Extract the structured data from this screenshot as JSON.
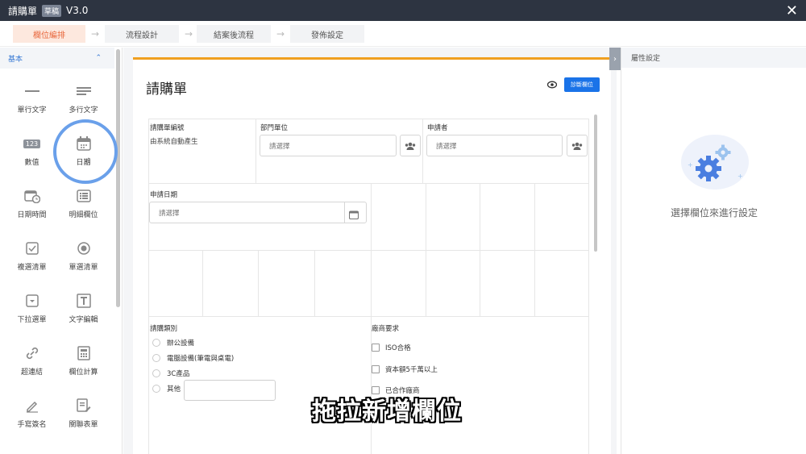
{
  "titlebar": {
    "title": "請購單",
    "badge": "草稿",
    "version": "V3.0"
  },
  "steps": [
    "欄位編排",
    "流程設計",
    "結案後流程",
    "發佈設定"
  ],
  "sidebar": {
    "section": "基本",
    "items": [
      {
        "label": "單行文字",
        "icon": "single-line-text-icon"
      },
      {
        "label": "多行文字",
        "icon": "multi-line-text-icon"
      },
      {
        "label": "數值",
        "icon": "number-icon",
        "glyph": "123"
      },
      {
        "label": "日期",
        "icon": "calendar-icon"
      },
      {
        "label": "日期時間",
        "icon": "datetime-icon"
      },
      {
        "label": "明細欄位",
        "icon": "detail-list-icon"
      },
      {
        "label": "複選清單",
        "icon": "checkbox-icon"
      },
      {
        "label": "單選清單",
        "icon": "radio-icon"
      },
      {
        "label": "下拉選單",
        "icon": "dropdown-icon"
      },
      {
        "label": "文字編輯",
        "icon": "text-editor-icon"
      },
      {
        "label": "超連結",
        "icon": "link-icon"
      },
      {
        "label": "欄位計算",
        "icon": "calculator-icon"
      },
      {
        "label": "手寫簽名",
        "icon": "signature-icon"
      },
      {
        "label": "關聯表單",
        "icon": "related-form-icon"
      }
    ]
  },
  "form": {
    "title": "請購單",
    "diagnose_button": "診斷欄位",
    "fields": {
      "serial_label": "請購單編號",
      "serial_value": "由系統自動產生",
      "dept_label": "部門單位",
      "dept_placeholder": "請選擇",
      "applicant_label": "申請者",
      "applicant_placeholder": "請選擇",
      "date_label": "申請日期",
      "date_placeholder": "請選擇",
      "category_label": "請購類別",
      "category_options": [
        "辦公設備",
        "電腦設備(筆電與桌電)",
        "3C產品",
        "其他"
      ],
      "vendor_label": "廠商要求",
      "vendor_options": [
        "ISO合格",
        "資本額5千萬以上",
        "已合作廠商"
      ]
    }
  },
  "right_panel": {
    "title": "屬性設定",
    "message": "選擇欄位來進行設定"
  },
  "caption": "拖拉新增欄位",
  "colors": {
    "accent": "#1a73e8",
    "orange": "#f0a020",
    "step_active": "#e8663b"
  }
}
